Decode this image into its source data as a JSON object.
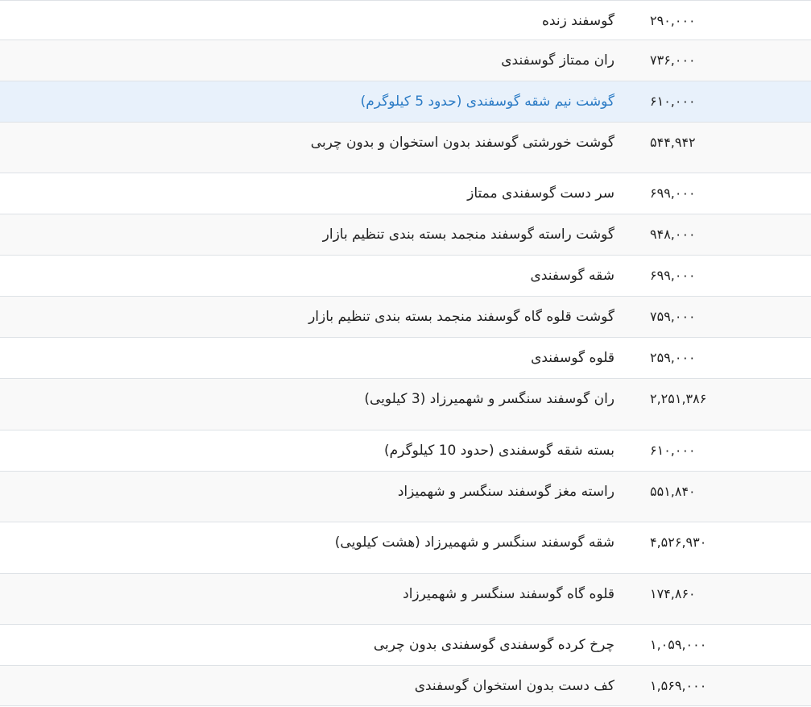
{
  "table": {
    "rows": [
      {
        "name": "گوسفند زنده",
        "price": "۲۹۰,۰۰۰"
      },
      {
        "name": "ران ممتاز گوسفندی",
        "price": "۷۳۶,۰۰۰"
      },
      {
        "name": "گوشت نیم شقه گوسفندی (حدود 5 کیلوگرم)",
        "price": "۶۱۰,۰۰۰"
      },
      {
        "name": "گوشت خورشتی گوسفند بدون استخوان و بدون چربی",
        "price": "۵۴۴,۹۴۲"
      },
      {
        "name": "سر دست گوسفندی ممتاز",
        "price": "۶۹۹,۰۰۰"
      },
      {
        "name": "گوشت راسته گوسفند منجمد بسته بندی تنظیم بازار",
        "price": "۹۴۸,۰۰۰"
      },
      {
        "name": "شقه گوسفندی",
        "price": "۶۹۹,۰۰۰"
      },
      {
        "name": "گوشت قلوه گاه گوسفند منجمد بسته بندی تنظیم بازار",
        "price": "۷۵۹,۰۰۰"
      },
      {
        "name": "قلوه گوسفندی",
        "price": "۲۵۹,۰۰۰"
      },
      {
        "name": "ران گوسفند سنگسر و شهمیرزاد (3 کیلویی)",
        "price": "۲,۲۵۱,۳۸۶"
      },
      {
        "name": "بسته شقه گوسفندی (حدود 10 کیلوگرم)",
        "price": "۶۱۰,۰۰۰"
      },
      {
        "name": "راسته مغز گوسفند سنگسر و شهمیزاد",
        "price": "۵۵۱,۸۴۰"
      },
      {
        "name": "شقه گوسفند سنگسر و شهمیرزاد (هشت کیلویی)",
        "price": "۴,۵۲۶,۹۳۰"
      },
      {
        "name": "قلوه گاه گوسفند سنگسر و شهمیرزاد",
        "price": "۱۷۴,۸۶۰"
      },
      {
        "name": "چرخ کرده گوسفندی گوسفندی بدون چربی",
        "price": "۱,۰۵۹,۰۰۰"
      },
      {
        "name": "کف دست بدون استخوان گوسفندی",
        "price": "۱,۵۶۹,۰۰۰"
      }
    ]
  },
  "colors": {
    "link": "#2b7bc5",
    "highlight_row": "#e8f1fb",
    "border": "#dee2e6"
  }
}
